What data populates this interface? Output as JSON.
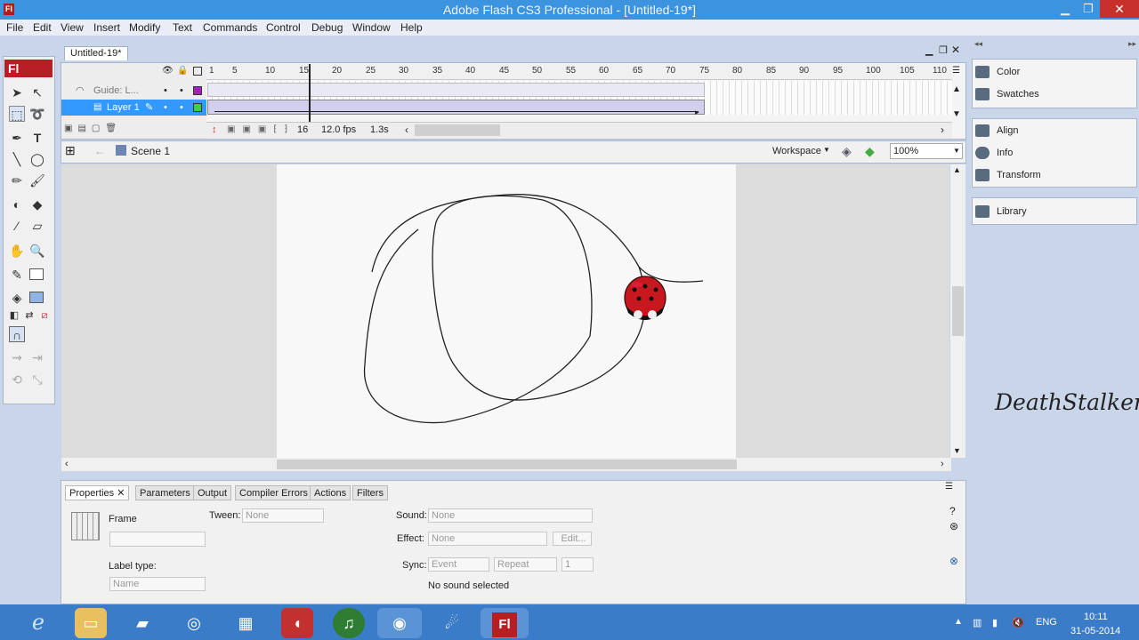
{
  "window": {
    "title": "Adobe Flash CS3 Professional - [Untitled-19*]",
    "app_icon": "Fl",
    "minimize": "▁",
    "maximize": "❐",
    "close": "✕"
  },
  "menu": [
    "File",
    "Edit",
    "View",
    "Insert",
    "Modify",
    "Text",
    "Commands",
    "Control",
    "Debug",
    "Window",
    "Help"
  ],
  "toolbox": {
    "logo": "Fl"
  },
  "document": {
    "tab_label": "Untitled-19*"
  },
  "timeline": {
    "layers": [
      {
        "name": "Guide: L...",
        "color": "#a020c0"
      },
      {
        "name": "Layer 1",
        "color": "#44cc44",
        "selected": true
      }
    ],
    "ruler_ticks": [
      "1",
      "5",
      "10",
      "15",
      "20",
      "25",
      "30",
      "35",
      "40",
      "45",
      "50",
      "55",
      "60",
      "65",
      "70",
      "75",
      "80",
      "85",
      "90",
      "95",
      "100",
      "105",
      "110"
    ],
    "current_frame": "16",
    "frame_rate": "12.0 fps",
    "elapsed": "1.3s"
  },
  "editbar": {
    "scene": "Scene 1",
    "workspace": "Workspace",
    "zoom": "100%"
  },
  "properties": {
    "tabs": [
      "Properties",
      "Parameters",
      "Output",
      "Compiler Errors",
      "Actions",
      "Filters"
    ],
    "frame_label": "Frame",
    "tween_label": "Tween:",
    "tween_value": "None",
    "label_type_label": "Label type:",
    "label_type_value": "Name",
    "sound_label": "Sound:",
    "sound_value": "None",
    "effect_label": "Effect:",
    "effect_value": "None",
    "edit_button": "Edit...",
    "sync_label": "Sync:",
    "sync_value": "Event",
    "repeat_value": "Repeat",
    "repeat_count": "1",
    "no_sound": "No sound selected"
  },
  "right_panels": {
    "group1": [
      "Color",
      "Swatches"
    ],
    "group2": [
      "Align",
      "Info",
      "Transform"
    ],
    "group3": [
      "Library"
    ]
  },
  "watermark": "DeathStalker",
  "taskbar": {
    "lang": "ENG",
    "time": "10:11",
    "date": "31-05-2014"
  }
}
